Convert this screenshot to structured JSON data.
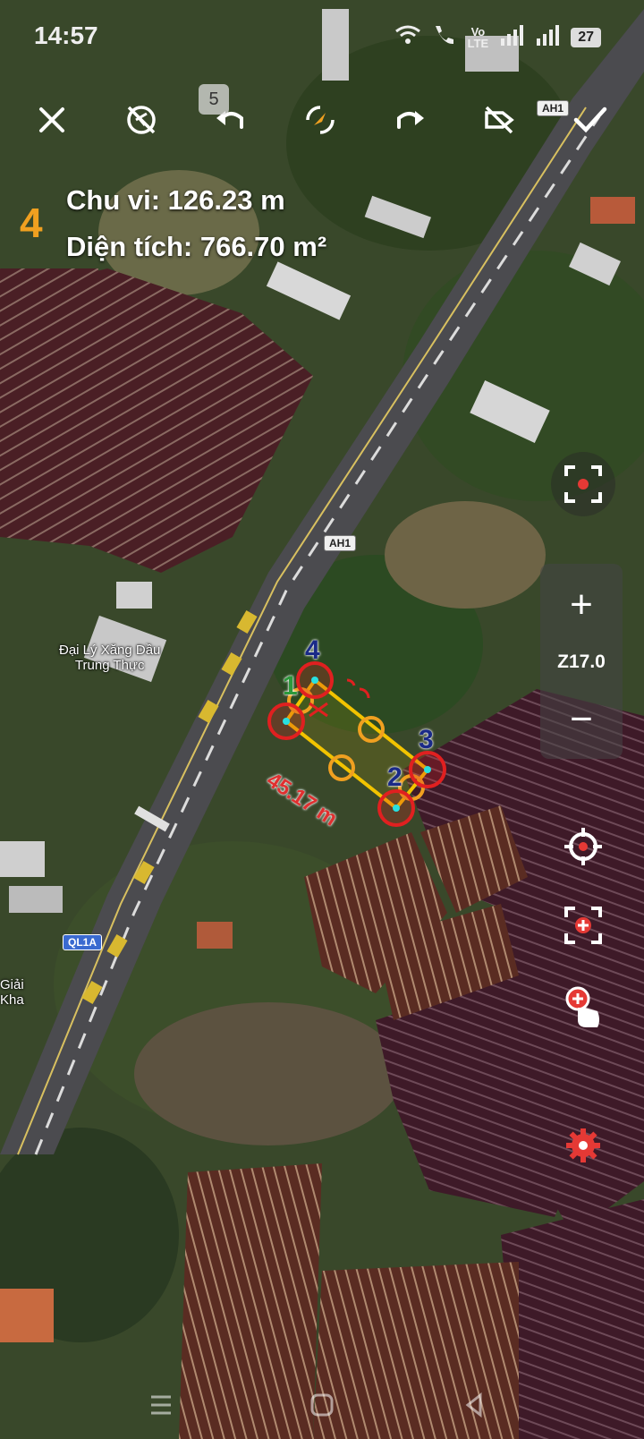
{
  "status_bar": {
    "time": "14:57",
    "lte_label": "Vo\nLTE",
    "battery": "27"
  },
  "toolbar": {
    "undo_count": "5",
    "buttons": [
      "close-icon",
      "gps-off-icon",
      "undo-icon",
      "compass-icon",
      "redo-icon",
      "label-off-icon",
      "checkmark-icon"
    ]
  },
  "measurement": {
    "point_count": "4",
    "perimeter_text": "Chu vi: 126.23 m",
    "area_text": "Diện tích: 766.70 m²",
    "edge_length_text": "45.17 m"
  },
  "points": [
    {
      "label": "1",
      "color": "#2c9a3c"
    },
    {
      "label": "2",
      "color": "#1a2a88"
    },
    {
      "label": "3",
      "color": "#1a2a88"
    },
    {
      "label": "4",
      "color": "#1a2a88"
    }
  ],
  "map_labels": {
    "highway_shield_1": "AH1",
    "highway_shield_2": "AH1",
    "route_shield": "QL1A",
    "poi_fuel": "Đại Lý Xăng Dầu\nTrung Thực",
    "poi_partial": "Giải\nKha"
  },
  "zoom": {
    "plus": "+",
    "level": "Z17.0",
    "minus": "−"
  },
  "colors": {
    "accent_orange": "#f0a020",
    "polygon_yellow": "#f2c300",
    "marker_red": "#e02020",
    "record_red": "#e53935"
  }
}
